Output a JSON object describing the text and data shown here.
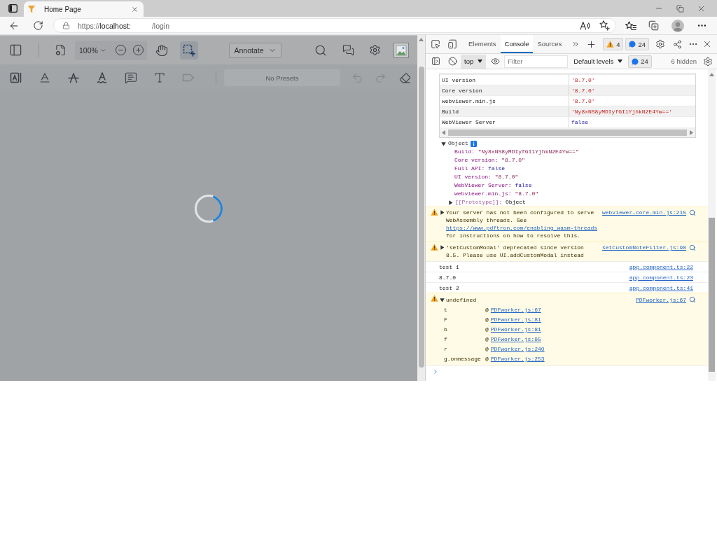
{
  "browser": {
    "tabs": [
      {
        "title": "Home Page",
        "selected": true
      }
    ],
    "address": {
      "scheme": "https://",
      "host": "localhost:",
      "path": "/login"
    }
  },
  "viewer": {
    "zoom": "100%",
    "mode": "Annotate",
    "tools": [
      {
        "kind": "pan",
        "selected": false
      },
      {
        "kind": "area-select",
        "selected": true
      }
    ],
    "annotation_tools": [
      {
        "kind": "free-text",
        "disabled": false
      },
      {
        "kind": "underline",
        "disabled": false
      },
      {
        "kind": "strikeout",
        "disabled": false
      },
      {
        "kind": "squiggly",
        "disabled": false
      },
      {
        "kind": "comment",
        "disabled": false
      },
      {
        "kind": "text",
        "disabled": false
      },
      {
        "kind": "callout",
        "disabled": true
      }
    ],
    "presets": "No Presets",
    "history": [
      {
        "kind": "undo",
        "disabled": true
      },
      {
        "kind": "redo",
        "disabled": true
      }
    ],
    "document": {
      "loading": true
    }
  },
  "devtools": {
    "tabs": [
      {
        "label": "Elements",
        "selected": false
      },
      {
        "label": "Console",
        "selected": true
      },
      {
        "label": "Sources",
        "selected": false
      }
    ],
    "counts": {
      "warnings": "4",
      "messages": "24"
    },
    "console_toolbar": {
      "context": "top",
      "filter_placeholder": "Filter",
      "levels": "Default levels",
      "messages": "24",
      "hidden": "6 hidden"
    },
    "table": {
      "rows": [
        {
          "key": "UI version",
          "value": "'8.7.0'",
          "kind": "string"
        },
        {
          "key": "Core version",
          "value": "'8.7.0'",
          "kind": "string"
        },
        {
          "key": "webviewer.min.js",
          "value": "'8.7.0'",
          "kind": "string"
        },
        {
          "key": "Build",
          "value": "'Ny8xNS8yMDIyfGI1YjhkN2E4Yw=='",
          "kind": "string"
        },
        {
          "key": "WebViewer Server",
          "value": "false",
          "kind": "boolean"
        }
      ]
    },
    "object": {
      "label": "Object",
      "expanded": true,
      "properties": [
        {
          "name": "Build:",
          "value": "\"Ny8xNS8yMDIyfGI1YjhkN2E4Yw==\"",
          "kind": "string"
        },
        {
          "name": "Core version:",
          "value": "\"8.7.0\"",
          "kind": "string"
        },
        {
          "name": "Full API:",
          "value": "false",
          "kind": "boolean"
        },
        {
          "name": "UI version:",
          "value": "\"8.7.0\"",
          "kind": "string"
        },
        {
          "name": "WebViewer Server:",
          "value": "false",
          "kind": "boolean"
        },
        {
          "name": "webviewer.min.js:",
          "value": "\"8.7.0\"",
          "kind": "string"
        }
      ],
      "prototype": {
        "name": "[[Prototype]]:",
        "value": "Object",
        "expanded": false
      }
    },
    "messages": [
      {
        "kind": "warning",
        "expanded": false,
        "parts": [
          {
            "text": "Your server has not been configured to serve WebAssembly threads. See "
          },
          {
            "link": "https://www.pdftron.com/enabling_wasm-threads"
          },
          {
            "text": " for instructions on how to resolve this."
          }
        ],
        "source": "webviewer-core.min.js:215"
      },
      {
        "kind": "warning",
        "expanded": false,
        "parts": [
          {
            "text": "'setCustomModal' deprecated since version 8.5. Please use UI.addCustomModal instead"
          }
        ],
        "source": "setCustomNoteFilter.js:98"
      },
      {
        "kind": "log",
        "parts": [
          {
            "text": "test 1"
          }
        ],
        "source": "app.component.ts:22"
      },
      {
        "kind": "log",
        "parts": [
          {
            "text": "8.7.0"
          }
        ],
        "source": "app.component.ts:23"
      },
      {
        "kind": "log",
        "parts": [
          {
            "text": "test 2"
          }
        ],
        "source": "app.component.ts:41"
      },
      {
        "kind": "warning",
        "expanded": true,
        "parts": [
          {
            "text": "undefined"
          }
        ],
        "source": "PDFworker.js:67",
        "stack": [
          {
            "function": "t",
            "at": "@",
            "source": "PDFworker.js:67"
          },
          {
            "function": "F",
            "at": "@",
            "source": "PDFworker.js:81"
          },
          {
            "function": "b",
            "at": "@",
            "source": "PDFworker.js:81"
          },
          {
            "function": "f",
            "at": "@",
            "source": "PDFworker.js:95"
          },
          {
            "function": "r",
            "at": "@",
            "source": "PDFworker.js:240"
          },
          {
            "function": "g.onmessage",
            "at": "@",
            "source": "PDFworker.js:253"
          }
        ]
      }
    ]
  }
}
